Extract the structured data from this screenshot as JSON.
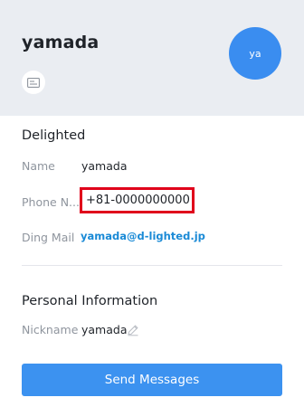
{
  "header": {
    "name": "yamada",
    "avatar_initials": "ya",
    "card_icon": "business-card-icon",
    "avatar_color": "#3a8df0",
    "background_color": "#eaedf2"
  },
  "organization": {
    "name": "Delighted"
  },
  "fields": {
    "name_label": "Name",
    "name_value": "yamada",
    "phone_label": "Phone N...",
    "phone_value": "+81-0000000000",
    "phone_highlight_color": "#e0001b",
    "mail_label": "Ding Mail",
    "mail_value": "yamada@d-lighted.jp",
    "mail_color": "#1a8ad6"
  },
  "personal": {
    "title": "Personal Information",
    "nickname_label": "Nickname",
    "nickname_value": "yamada",
    "edit_icon": "pencil-icon"
  },
  "actions": {
    "send_label": "Send Messages",
    "button_color": "#3c92f0"
  }
}
